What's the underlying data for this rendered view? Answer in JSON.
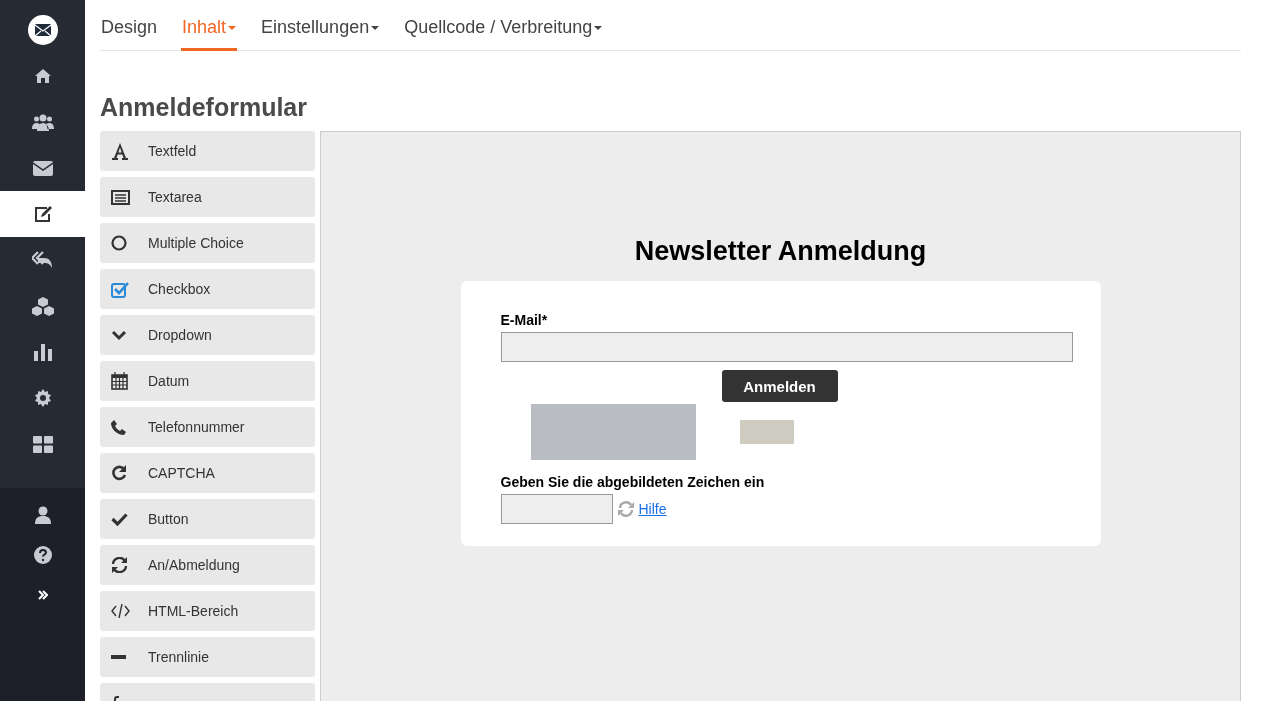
{
  "sidebar": {
    "items": [
      {
        "kind": "home",
        "selected": false
      },
      {
        "kind": "users",
        "selected": false
      },
      {
        "kind": "mail",
        "selected": false
      },
      {
        "kind": "edit",
        "selected": true
      },
      {
        "kind": "reply",
        "selected": false
      },
      {
        "kind": "cubes",
        "selected": false
      },
      {
        "kind": "chart",
        "selected": false
      },
      {
        "kind": "gear",
        "selected": false
      },
      {
        "kind": "grid",
        "selected": false
      }
    ],
    "bottom_items": [
      {
        "kind": "user"
      },
      {
        "kind": "help"
      },
      {
        "kind": "expand"
      }
    ]
  },
  "tabs": [
    {
      "label": "Design",
      "selected": false,
      "dropdown": false
    },
    {
      "label": "Inhalt",
      "selected": true,
      "dropdown": true
    },
    {
      "label": "Einstellungen",
      "selected": false,
      "dropdown": true
    },
    {
      "label": "Quellcode / Verbreitung",
      "selected": false,
      "dropdown": true
    }
  ],
  "title": "Anmeldeformular",
  "palette": [
    {
      "kind": "text",
      "label": "Textfeld"
    },
    {
      "kind": "textarea",
      "label": "Textarea"
    },
    {
      "kind": "radio",
      "label": "Multiple Choice"
    },
    {
      "kind": "checkbox",
      "label": "Checkbox"
    },
    {
      "kind": "dropdown",
      "label": "Dropdown"
    },
    {
      "kind": "date",
      "label": "Datum"
    },
    {
      "kind": "phone",
      "label": "Telefonnummer"
    },
    {
      "kind": "captcha",
      "label": "CAPTCHA"
    },
    {
      "kind": "button",
      "label": "Button"
    },
    {
      "kind": "sync",
      "label": "An/Abmeldung"
    },
    {
      "kind": "code",
      "label": "HTML-Bereich"
    },
    {
      "kind": "divider",
      "label": "Trennlinie"
    },
    {
      "kind": "facebook"
    }
  ],
  "form": {
    "heading": "Newsletter Anmeldung",
    "email_label": "E-Mail*",
    "submit": "Anmelden",
    "captcha_label": "Geben Sie die abgebildeten Zeichen ein",
    "help_link": "Hilfe"
  }
}
